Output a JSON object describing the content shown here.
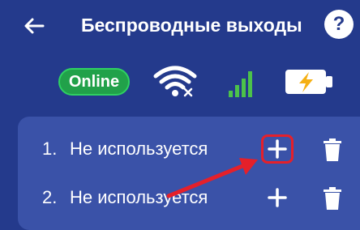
{
  "header": {
    "title": "Беспроводные выходы",
    "back_icon": "arrow-left-icon",
    "help_label": "?"
  },
  "status": {
    "online_label": "Online",
    "wifi_icon": "wifi-disconnected-icon",
    "signal_icon": "cellular-signal-icon",
    "battery_icon": "battery-charging-icon"
  },
  "outputs": [
    {
      "number": "1.",
      "label": "Не используется"
    },
    {
      "number": "2.",
      "label": "Не используется"
    }
  ],
  "colors": {
    "background": "#243a8c",
    "panel": "#3a52a8",
    "online": "#21a14a",
    "highlight": "#e5202a",
    "battery_bolt": "#f5b014"
  }
}
